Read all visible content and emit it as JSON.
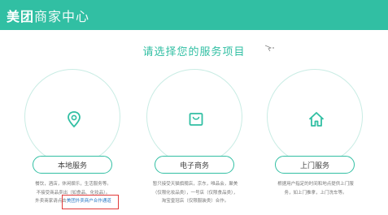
{
  "header": {
    "brand": "美团",
    "title_rest": "商家中心"
  },
  "page_title": "请选择您的服务项目",
  "colors": {
    "accent": "#31bfa3",
    "link": "#2a79c6",
    "highlight": "#e23b3b"
  },
  "services": [
    {
      "id": "local",
      "icon": "location-pin-icon",
      "label": "本地服务",
      "desc": [
        "餐饮，酒店，休闲娱乐，生活服务等。",
        "不接受商品卖出（如食品、化妆品）。"
      ],
      "desc_prefix": "外卖商家请点击",
      "link_text": "美团外卖商户合作通道"
    },
    {
      "id": "ecom",
      "icon": "shopping-bag-icon",
      "label": "电子商务",
      "desc": [
        "暂只接受天猫旗舰店，京东，唯品会，聚美",
        "（仅限化妆品类），一号店（仅限食品类），",
        "淘宝皇冠店（仅限服装类）合作。"
      ]
    },
    {
      "id": "home",
      "icon": "home-icon",
      "label": "上门服务",
      "desc": [
        "根据用户指定的时间和地点提供上门服",
        "务，如上门推拿，上门洗车等。"
      ]
    }
  ]
}
